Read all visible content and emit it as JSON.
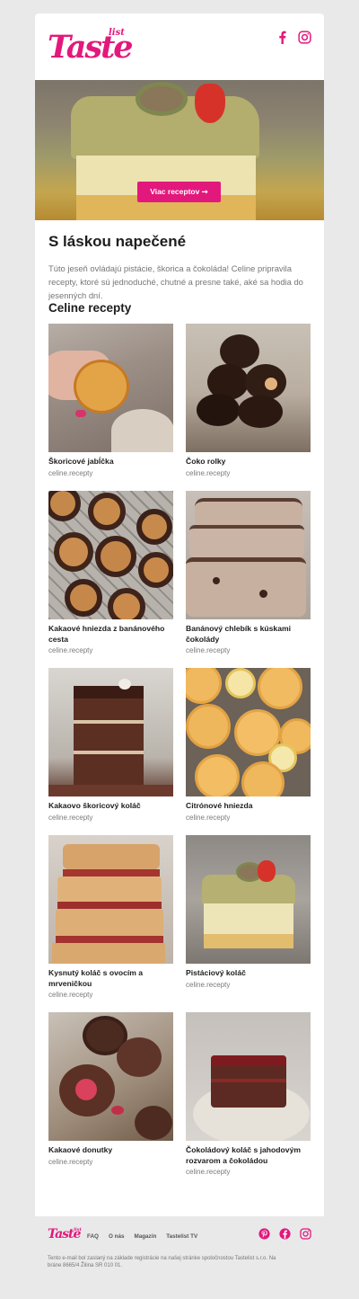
{
  "brand": {
    "logo_text": "Taste",
    "logo_sub": "list",
    "accent_color": "#e3187d"
  },
  "header": {
    "social_icons": [
      "facebook-icon",
      "instagram-icon"
    ]
  },
  "hero": {
    "button_label": "Viac receptov ➞"
  },
  "intro": {
    "title": "S láskou napečené",
    "text": "Túto jeseň ovládajú pistácie, škorica a čokoláda! Celine pripravila recepty, ktoré sú jednoduché, chutné a presne také, aké sa hodia do jesenných dní."
  },
  "section_title": "Celine recepty",
  "recipes": [
    {
      "name": "Škoricové jabĺčka",
      "author": "celine.recepty"
    },
    {
      "name": "Čoko rolky",
      "author": "celine.recepty"
    },
    {
      "name": "Kakaové hniezda z banánového cesta",
      "author": "celine.recepty"
    },
    {
      "name": "Banánový chlebík s kúskami čokolády",
      "author": "celine.recepty"
    },
    {
      "name": "Kakaovo škoricový koláč",
      "author": "celine.recepty"
    },
    {
      "name": "Citrónové hniezda",
      "author": "celine.recepty"
    },
    {
      "name": "Kysnutý koláč s ovocím a mrveničkou",
      "author": "celine.recepty"
    },
    {
      "name": "Pistáciový koláč",
      "author": "celine.recepty"
    },
    {
      "name": "Kakaové donutky",
      "author": "celine.recepty"
    },
    {
      "name": "Čokoládový koláč s jahodovým rozvarom a čokoládou",
      "author": "celine.recepty"
    }
  ],
  "footer": {
    "logo_text": "Taste",
    "logo_sub": "list",
    "links": [
      "FAQ",
      "O nás",
      "Magazín",
      "Tastelist TV"
    ],
    "social_icons": [
      "pinterest-icon",
      "facebook-icon",
      "instagram-icon"
    ],
    "legal": "Tento e-mail bol zaslaný na základe registrácie na našej stránke spoločnostou Tastelist s.r.o. Na bráne 8665/4 Žilina SR 010 01."
  }
}
